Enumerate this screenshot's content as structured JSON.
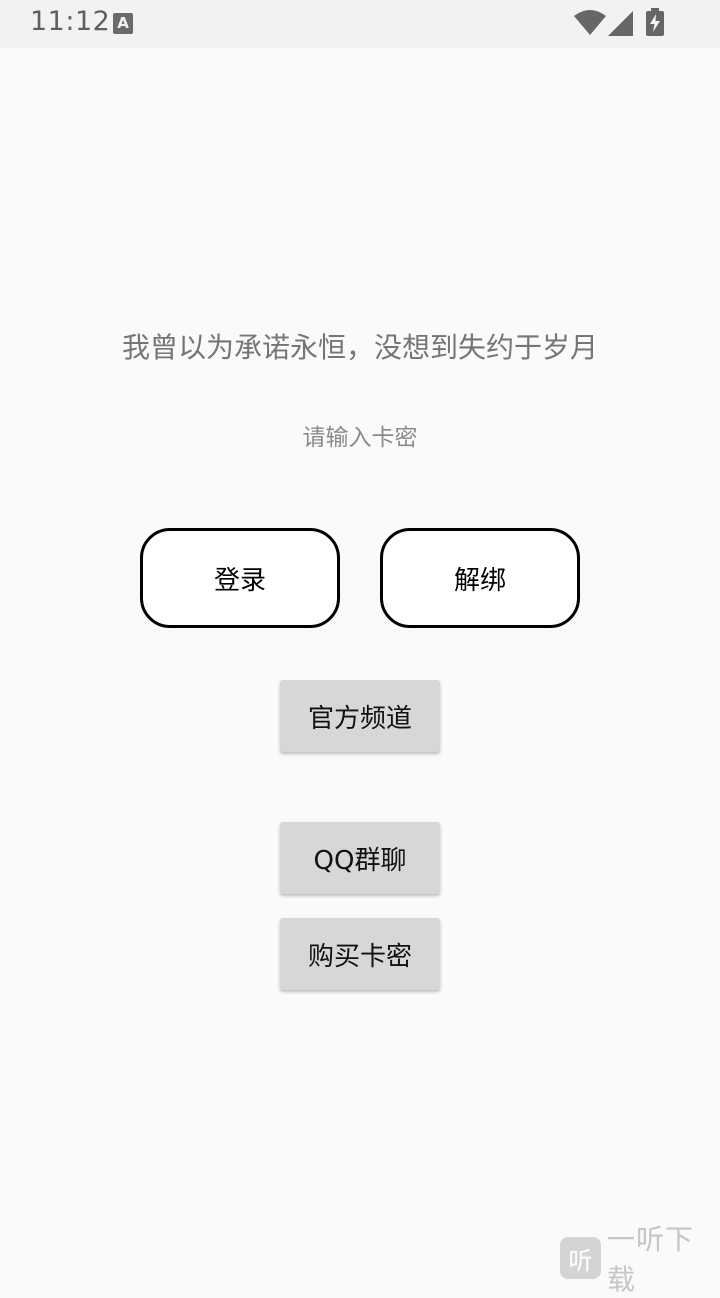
{
  "status_bar": {
    "time": "11:12",
    "notification_icon_letter": "A",
    "icons": [
      "wifi-icon",
      "cell-signal-icon",
      "battery-charging-icon"
    ]
  },
  "main": {
    "slogan": "我曾以为承诺永恒，没想到失约于岁月",
    "card_input_placeholder": "请输入卡密",
    "login_label": "登录",
    "unbind_label": "解绑",
    "official_channel_label": "官方频道",
    "qq_group_label": "QQ群聊",
    "buy_card_label": "购买卡密"
  },
  "watermark": {
    "logo_char": "听",
    "text": "一听下载"
  },
  "colors": {
    "background": "#fafafa",
    "status_bar": "#f2f2f2",
    "gray_button": "#d6d7d7",
    "outline_border": "#000000",
    "slogan_text": "#757575"
  }
}
